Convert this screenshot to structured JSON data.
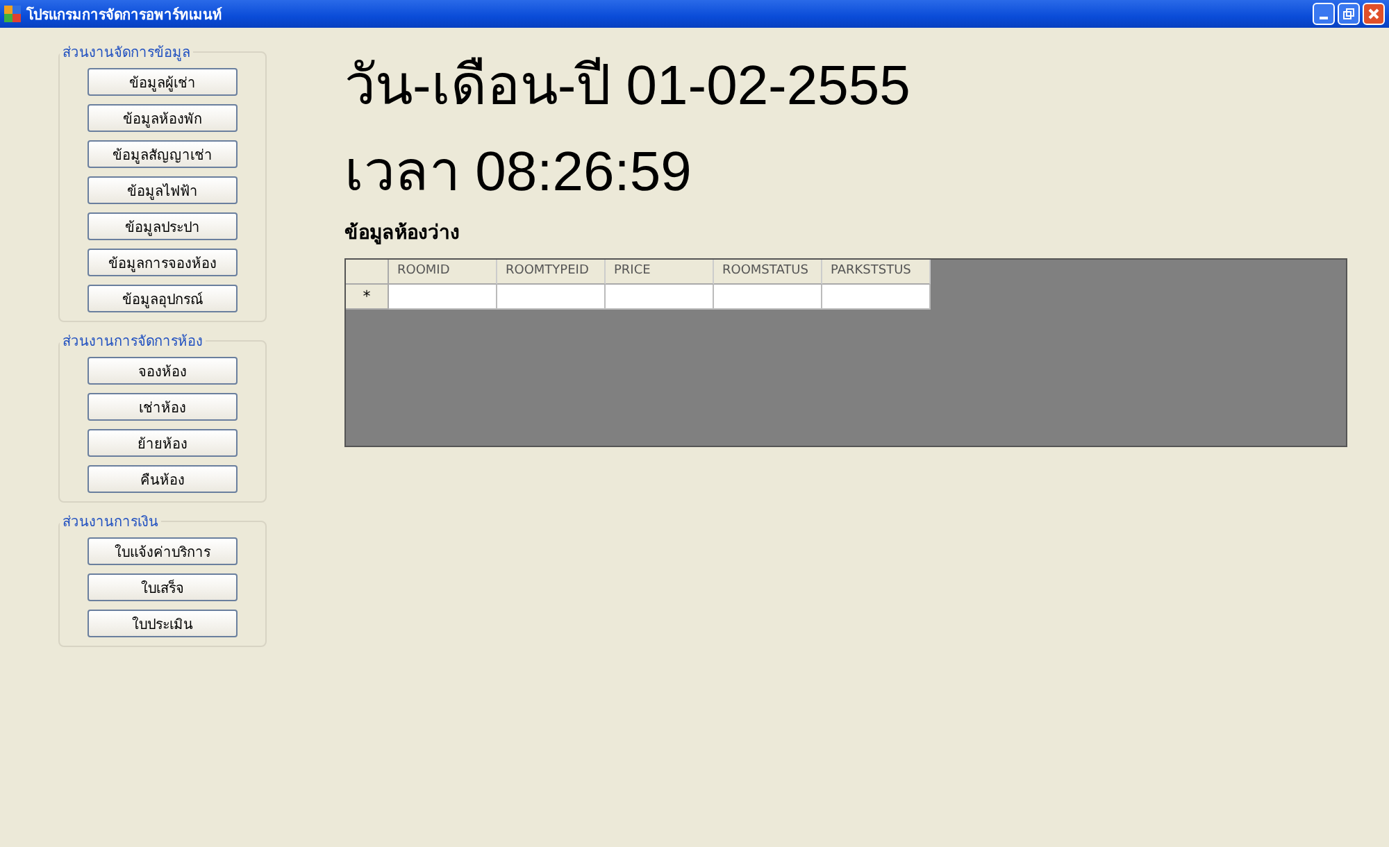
{
  "window": {
    "title": "โปรแกรมการจัดการอพาร์ทเมนท์"
  },
  "groups": [
    {
      "title": "ส่วนงานจัดการข้อมูล",
      "buttons": [
        "ข้อมูลผู้เช่า",
        "ข้อมูลห้องพัก",
        "ข้อมูลสัญญาเช่า",
        "ข้อมูลไฟฟ้า",
        "ข้อมูลประปา",
        "ข้อมูลการจองห้อง",
        "ข้อมูลอุปกรณ์"
      ]
    },
    {
      "title": "ส่วนงานการจัดการห้อง",
      "buttons": [
        "จองห้อง",
        "เช่าห้อง",
        "ย้ายห้อง",
        "คืนห้อง"
      ]
    },
    {
      "title": "ส่วนงานการเงิน",
      "buttons": [
        "ใบแจ้งค่าบริการ",
        "ใบเสร็จ",
        "ใบประเมิน"
      ]
    }
  ],
  "date_label": "วัน-เดือน-ปี 01-02-2555",
  "time_label": "เวลา 08:26:59",
  "table": {
    "title": "ข้อมูลห้องว่าง",
    "columns": [
      "ROOMID",
      "ROOMTYPEID",
      "PRICE",
      "ROOMSTATUS",
      "PARKSTSTUS"
    ],
    "new_row_marker": "*"
  }
}
